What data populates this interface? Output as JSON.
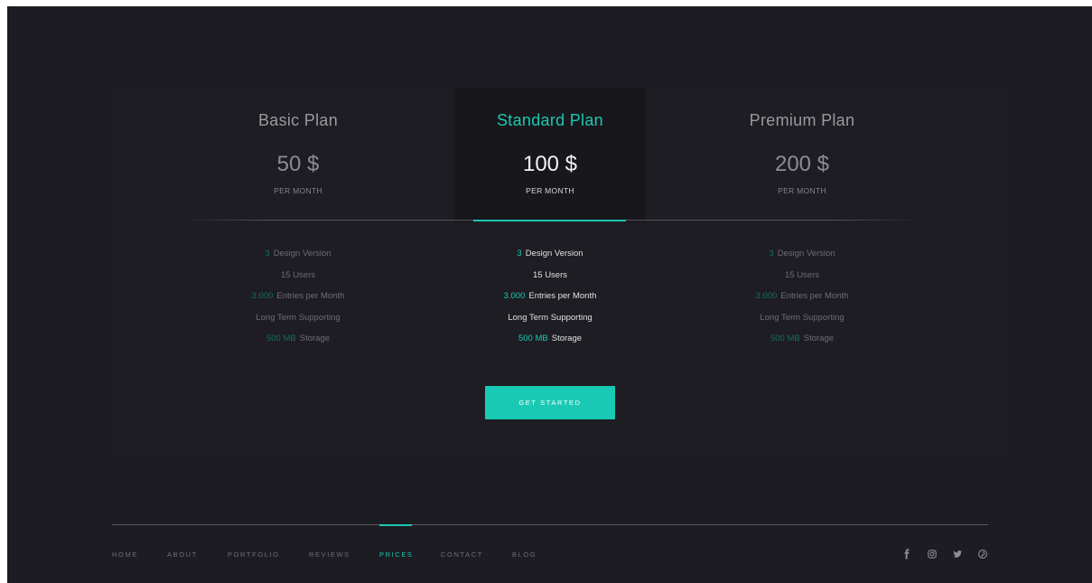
{
  "plans": [
    {
      "title": "Basic Plan",
      "price": "50 $",
      "period": "PER MONTH",
      "features": [
        {
          "accent": "3",
          "text": "Design Version"
        },
        {
          "accent": "",
          "text": "15 Users"
        },
        {
          "accent": "3.000",
          "text": "Entries per Month"
        },
        {
          "accent": "",
          "text": "Long Term Supporting"
        },
        {
          "accent": "500 MB",
          "text": "Storage"
        }
      ]
    },
    {
      "title": "Standard Plan",
      "price": "100 $",
      "period": "PER MONTH",
      "features": [
        {
          "accent": "3",
          "text": "Design Version"
        },
        {
          "accent": "",
          "text": "15 Users"
        },
        {
          "accent": "3.000",
          "text": "Entries per Month"
        },
        {
          "accent": "",
          "text": "Long Term Supporting"
        },
        {
          "accent": "500 MB",
          "text": "Storage"
        }
      ]
    },
    {
      "title": "Premium Plan",
      "price": "200 $",
      "period": "PER MONTH",
      "features": [
        {
          "accent": "3",
          "text": "Design Version"
        },
        {
          "accent": "",
          "text": "15 Users"
        },
        {
          "accent": "3.000",
          "text": "Entries per Month"
        },
        {
          "accent": "",
          "text": "Long Term Supporting"
        },
        {
          "accent": "500 MB",
          "text": "Storage"
        }
      ]
    }
  ],
  "cta": {
    "label": "GET STARTED"
  },
  "nav": {
    "items": [
      "HOME",
      "ABOUT",
      "PORTFOLIO",
      "REVIEWS",
      "PRICES",
      "CONTACT",
      "BLOG"
    ],
    "active": "PRICES"
  },
  "social": {
    "icons": [
      "facebook-icon",
      "instagram-icon",
      "twitter-icon",
      "pinterest-icon"
    ]
  },
  "colors": {
    "accent": "#19c9b3",
    "background": "#1d1c22",
    "featured_card": "#18171c"
  }
}
